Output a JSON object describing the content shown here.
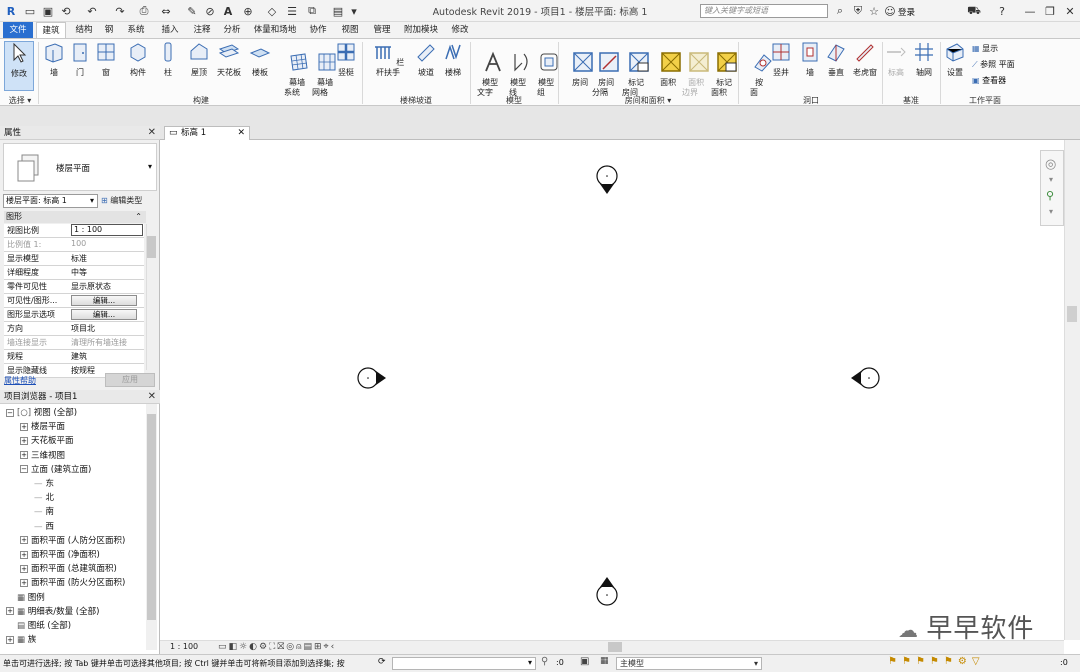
{
  "app_title": "Autodesk Revit 2019 -   项目1 - 楼层平面: 标高 1",
  "search_placeholder": "键入关键字或短语",
  "signin_label": "登录",
  "tabs": [
    "文件",
    "建筑",
    "结构",
    "钢",
    "系统",
    "插入",
    "注释",
    "分析",
    "体量和场地",
    "协作",
    "视图",
    "管理",
    "附加模块",
    "修改"
  ],
  "ribbon": {
    "select_group": {
      "modify_label": "修改",
      "select_label": "选择 ▾"
    },
    "build_tools": [
      "墙",
      "门",
      "窗",
      "构件",
      "柱",
      "屋顶",
      "天花板",
      "楼板",
      "幕墙\n系统",
      "幕墙\n网格",
      "竖梃"
    ],
    "build_panel": "构建",
    "stair_tools": [
      "栏杆扶手",
      "坡道",
      "楼梯"
    ],
    "stair_panel": "楼梯坡道",
    "model_tools": [
      "模型\n文字",
      "模型\n线",
      "模型\n组"
    ],
    "model_panel": "模型",
    "room_tools": [
      "房间",
      "房间\n分隔",
      "标记\n房间",
      "面积",
      "面积\n边界",
      "标记\n面积"
    ],
    "room_panel": "房间和面积 ▾",
    "opening_tools": [
      "按\n面",
      "竖井",
      "墙",
      "垂直",
      "老虎窗"
    ],
    "opening_panel": "洞口",
    "datum_tools": [
      "标高",
      "轴网"
    ],
    "datum_panel": "基准",
    "workplane_tools": [
      "设置"
    ],
    "workplane_small": [
      "显示",
      "参照 平面",
      "查看器"
    ],
    "workplane_panel": "工作平面"
  },
  "properties": {
    "title": "属性",
    "type_name": "楼层平面",
    "type_selector": "楼层平面: 标高 1",
    "edit_type": "编辑类型",
    "group": "图形",
    "rows": [
      {
        "k": "视图比例",
        "v": "1 : 100",
        "kind": "input"
      },
      {
        "k": "比例值 1:",
        "v": "100",
        "kind": "dim"
      },
      {
        "k": "显示模型",
        "v": "标准",
        "kind": "text"
      },
      {
        "k": "详细程度",
        "v": "中等",
        "kind": "text"
      },
      {
        "k": "零件可见性",
        "v": "显示原状态",
        "kind": "text"
      },
      {
        "k": "可见性/图形...",
        "v": "编辑...",
        "kind": "button"
      },
      {
        "k": "图形显示选项",
        "v": "编辑...",
        "kind": "button"
      },
      {
        "k": "方向",
        "v": "项目北",
        "kind": "text"
      },
      {
        "k": "墙连接显示",
        "v": "清理所有墙连接",
        "kind": "dim"
      },
      {
        "k": "规程",
        "v": "建筑",
        "kind": "text"
      },
      {
        "k": "显示隐藏线",
        "v": "按规程",
        "kind": "text"
      }
    ],
    "help_link": "属性帮助",
    "apply": "应用"
  },
  "browser": {
    "title": "项目浏览器 - 项目1",
    "nodes": [
      {
        "label": "视图 (全部)",
        "level": 0,
        "ex": "−",
        "icon": "[○]"
      },
      {
        "label": "楼层平面",
        "level": 1,
        "ex": "+"
      },
      {
        "label": "天花板平面",
        "level": 1,
        "ex": "+"
      },
      {
        "label": "三维视图",
        "level": 1,
        "ex": "+"
      },
      {
        "label": "立面 (建筑立面)",
        "level": 1,
        "ex": "−"
      },
      {
        "label": "东",
        "level": 2,
        "ex": ""
      },
      {
        "label": "北",
        "level": 2,
        "ex": ""
      },
      {
        "label": "南",
        "level": 2,
        "ex": ""
      },
      {
        "label": "西",
        "level": 2,
        "ex": ""
      },
      {
        "label": "面积平面 (人防分区面积)",
        "level": 1,
        "ex": "+"
      },
      {
        "label": "面积平面 (净面积)",
        "level": 1,
        "ex": "+"
      },
      {
        "label": "面积平面 (总建筑面积)",
        "level": 1,
        "ex": "+"
      },
      {
        "label": "面积平面 (防火分区面积)",
        "level": 1,
        "ex": "+"
      },
      {
        "label": "图例",
        "level": 0,
        "ex": "",
        "icon": "▦"
      },
      {
        "label": "明细表/数量 (全部)",
        "level": 0,
        "ex": "+",
        "icon": "▦"
      },
      {
        "label": "图纸 (全部)",
        "level": 0,
        "ex": "",
        "icon": "▤"
      },
      {
        "label": "族",
        "level": 0,
        "ex": "+",
        "icon": "▦"
      },
      {
        "label": "组",
        "level": 0,
        "ex": "+",
        "icon": "▦"
      }
    ]
  },
  "doc_tab": "标高 1",
  "view_control": {
    "scale": "1 : 100"
  },
  "status": {
    "message": "单击可进行选择; 按 Tab 键并单击可选择其他项目; 按 Ctrl 键并单击可将新项目添加到选择集; 按",
    "zero_a": ":0",
    "model": "主模型",
    "zero_b": ":0"
  },
  "watermark": "早早软件",
  "colors": {
    "accent": "#2a6fd0",
    "ribbon_icon": "#3b6db3",
    "yellow": "#f2d048"
  }
}
